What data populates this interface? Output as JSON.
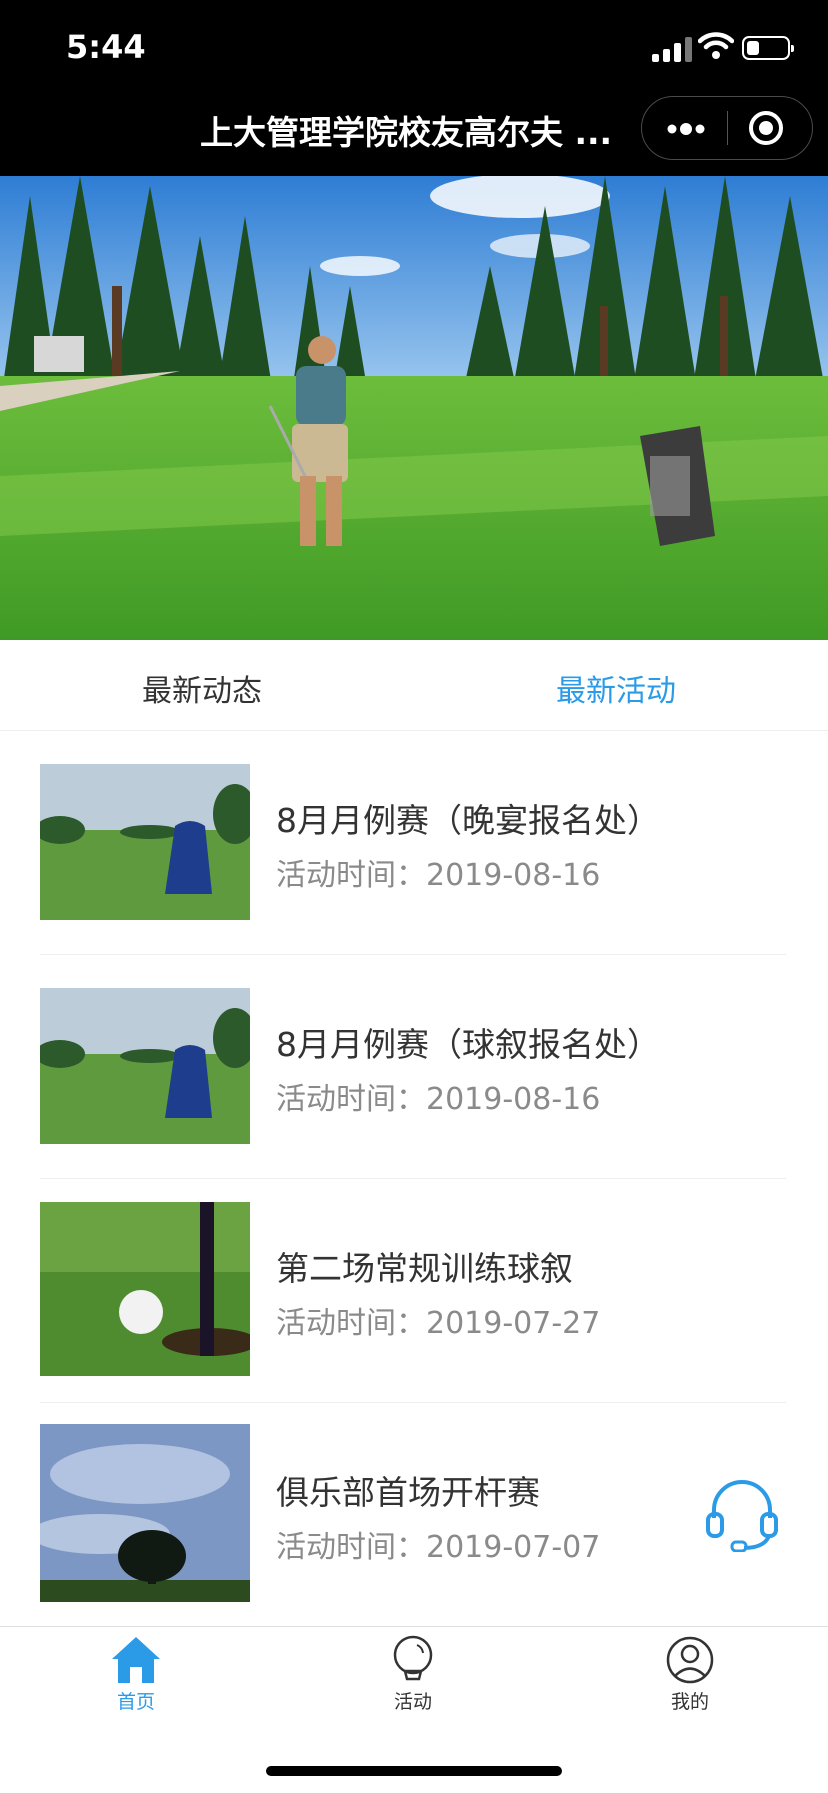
{
  "status_bar": {
    "time": "5:44"
  },
  "nav": {
    "title": "上大管理学院校友高尔夫 ..."
  },
  "tabs": {
    "left": "最新动态",
    "right": "最新活动"
  },
  "activities": [
    {
      "title": "8月月例赛（晚宴报名处）",
      "date_label": "活动时间：",
      "date": "2019-08-16"
    },
    {
      "title": "8月月例赛（球叙报名处）",
      "date_label": "活动时间：",
      "date": "2019-08-16"
    },
    {
      "title": "第二场常规训练球叙",
      "date_label": "活动时间：",
      "date": "2019-07-27"
    },
    {
      "title": "俱乐部首场开杆赛",
      "date_label": "活动时间：",
      "date": "2019-07-07"
    }
  ],
  "tabbar": {
    "home": "首页",
    "activity": "活动",
    "mine": "我的"
  },
  "colors": {
    "accent": "#2b9be8",
    "nav_bg": "#000000",
    "muted": "#8a8a8a"
  },
  "icons": [
    "more-dots-icon",
    "target-close-icon",
    "home-icon",
    "lightbulb-icon",
    "user-icon",
    "headset-icon"
  ]
}
